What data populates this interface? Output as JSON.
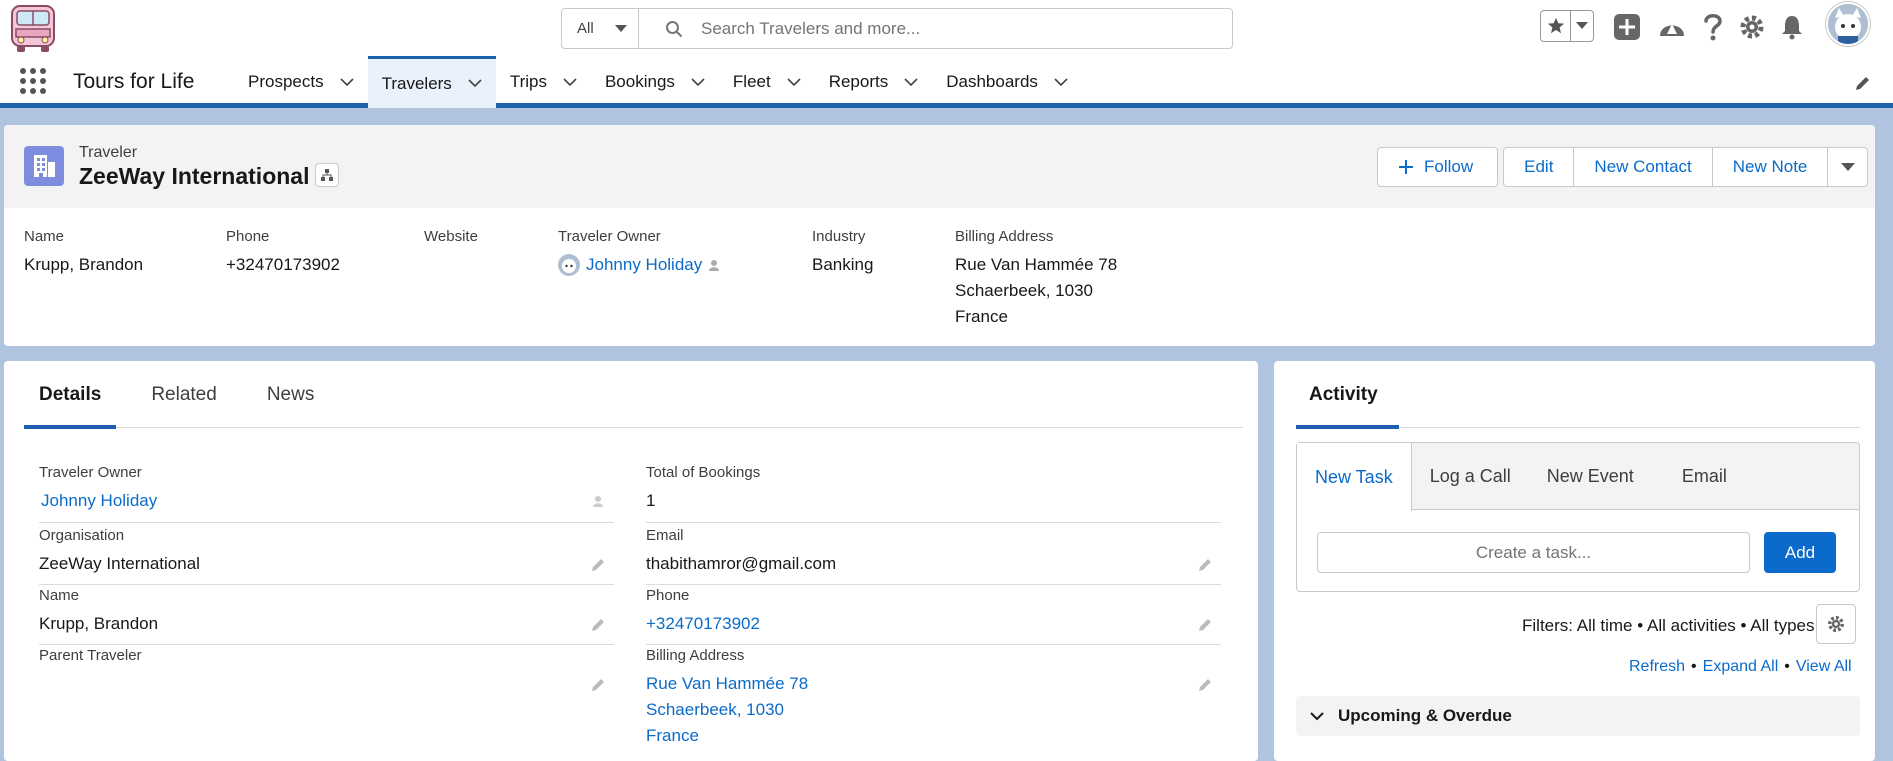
{
  "header": {
    "search_scope": "All",
    "search_placeholder": "Search Travelers and more..."
  },
  "nav": {
    "app_name": "Tours for Life",
    "items": [
      {
        "label": "Prospects"
      },
      {
        "label": "Travelers"
      },
      {
        "label": "Trips"
      },
      {
        "label": "Bookings"
      },
      {
        "label": "Fleet"
      },
      {
        "label": "Reports"
      },
      {
        "label": "Dashboards"
      }
    ],
    "active": "Travelers"
  },
  "record": {
    "type": "Traveler",
    "name": "ZeeWay International",
    "actions": {
      "follow": "Follow",
      "edit": "Edit",
      "new_contact": "New Contact",
      "new_note": "New Note"
    },
    "highlights": {
      "name_label": "Name",
      "name_value": "Krupp, Brandon",
      "phone_label": "Phone",
      "phone_value": "+32470173902",
      "website_label": "Website",
      "owner_label": "Traveler Owner",
      "owner_value": "Johnny Holiday",
      "industry_label": "Industry",
      "industry_value": "Banking",
      "billing_label": "Billing Address",
      "billing_line1": "Rue Van Hammée 78",
      "billing_line2": "Schaerbeek, 1030",
      "billing_line3": "France"
    }
  },
  "details": {
    "tabs": [
      "Details",
      "Related",
      "News"
    ],
    "fields": {
      "owner_label": "Traveler Owner",
      "owner_value": "Johnny Holiday",
      "org_label": "Organisation",
      "org_value": "ZeeWay International",
      "name_label": "Name",
      "name_value": "Krupp, Brandon",
      "parent_label": "Parent Traveler",
      "parent_value": "",
      "bookings_label": "Total of Bookings",
      "bookings_value": "1",
      "email_label": "Email",
      "email_value": "thabithamror@gmail.com",
      "phone_label": "Phone",
      "phone_value": "+32470173902",
      "billing_label": "Billing Address",
      "billing_line1": "Rue Van Hammée 78",
      "billing_line2": "Schaerbeek, 1030",
      "billing_line3": "France"
    }
  },
  "activity": {
    "title": "Activity",
    "composer_tabs": [
      "New Task",
      "Log a Call",
      "New Event",
      "Email"
    ],
    "task_placeholder": "Create a task...",
    "add_label": "Add",
    "filters": "Filters: All time • All activities • All types",
    "refresh": "Refresh",
    "expand_all": "Expand All",
    "view_all": "View All",
    "upcoming": "Upcoming & Overdue"
  },
  "colors": {
    "brand_blue": "#0b6bcb",
    "nav_accent": "#1e63a8",
    "record_icon": "#7f8de1"
  }
}
